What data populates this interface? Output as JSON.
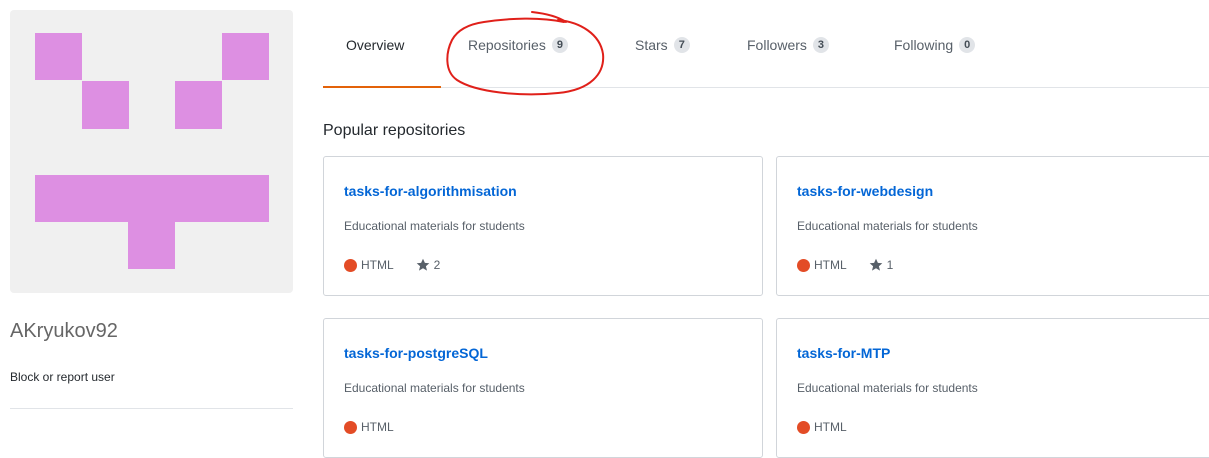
{
  "profile": {
    "username": "AKryukov92",
    "block_link": "Block or report user",
    "avatar_color": "#dd8fe2"
  },
  "tabs": [
    {
      "label": "Overview",
      "count": ""
    },
    {
      "label": "Repositories",
      "count": "9"
    },
    {
      "label": "Stars",
      "count": "7"
    },
    {
      "label": "Followers",
      "count": "3"
    },
    {
      "label": "Following",
      "count": "0"
    }
  ],
  "popular": {
    "title": "Popular repositories",
    "repos": [
      {
        "name": "tasks-for-algorithmisation",
        "description": "Educational materials for students",
        "language": "HTML",
        "stars": "2"
      },
      {
        "name": "tasks-for-webdesign",
        "description": "Educational materials for students",
        "language": "HTML",
        "stars": "1"
      },
      {
        "name": "tasks-for-postgreSQL",
        "description": "Educational materials for students",
        "language": "HTML",
        "stars": ""
      },
      {
        "name": "tasks-for-MTP",
        "description": "Educational materials for students",
        "language": "HTML",
        "stars": ""
      }
    ]
  },
  "colors": {
    "accent_underline": "#e36209",
    "link": "#0366d6",
    "html_language": "#e34c26",
    "annotation": "#e0201a"
  }
}
